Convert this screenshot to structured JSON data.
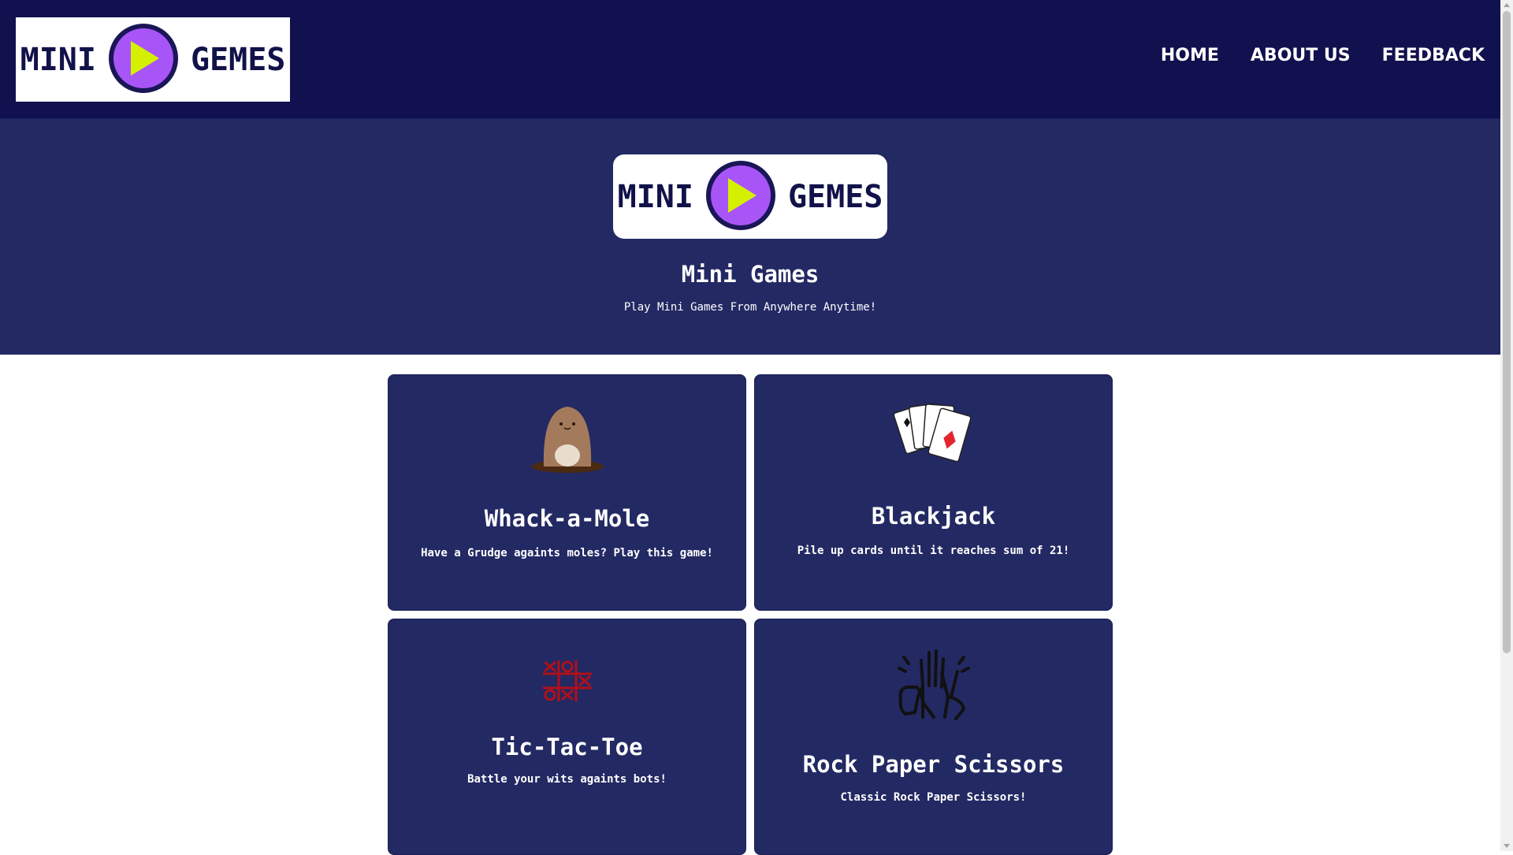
{
  "nav": {
    "logo": {
      "left": "MINI",
      "right": "GEMES"
    },
    "links": [
      {
        "label": "HOME"
      },
      {
        "label": "ABOUT US"
      },
      {
        "label": "FEEDBACK"
      }
    ]
  },
  "hero": {
    "logo": {
      "left": "MINI",
      "right": "GEMES"
    },
    "title": "Mini Games",
    "subtitle": "Play Mini Games From Anywhere Anytime!"
  },
  "games": [
    {
      "title": "Whack-a-Mole",
      "description": "Have a Grudge againts moles? Play this game!",
      "icon": "mole-icon"
    },
    {
      "title": "Blackjack",
      "description": "Pile up cards until it reaches sum of 21!",
      "icon": "playing-cards-icon"
    },
    {
      "title": "Tic-Tac-Toe",
      "description": "Battle your wits againts bots!",
      "icon": "tic-tac-toe-icon"
    },
    {
      "title": "Rock Paper Scissors",
      "description": "Classic Rock Paper Scissors!",
      "icon": "hand-gestures-icon"
    }
  ],
  "colors": {
    "navbar": "#11114f",
    "hero": "#232963",
    "card": "#232963",
    "logo_purple": "#a855f7",
    "logo_play": "#d4f000"
  }
}
